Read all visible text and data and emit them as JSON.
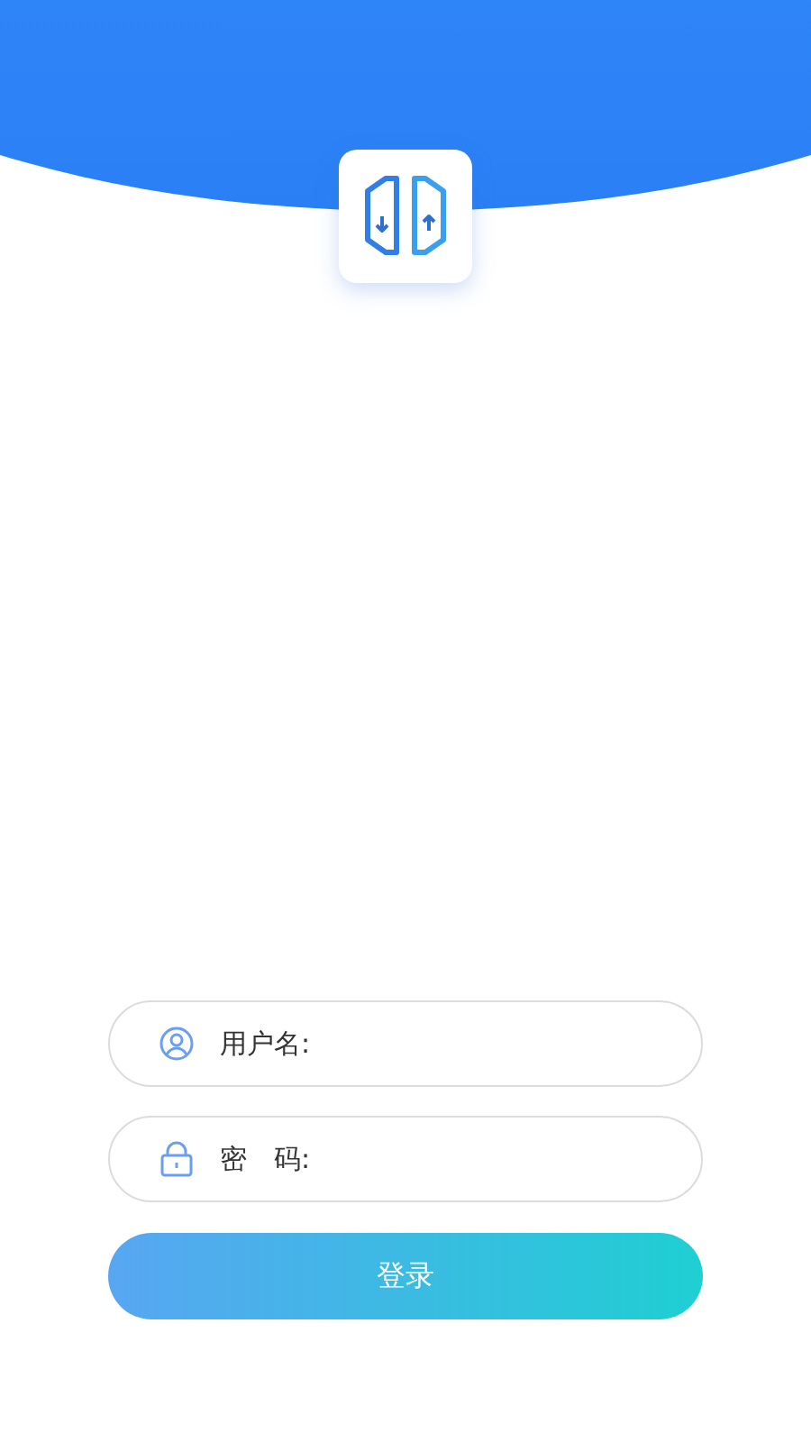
{
  "fields": [
    {
      "kind": "user",
      "label": "用户名:"
    },
    {
      "kind": "password",
      "label": "密　码:"
    }
  ],
  "login_button": "登录"
}
